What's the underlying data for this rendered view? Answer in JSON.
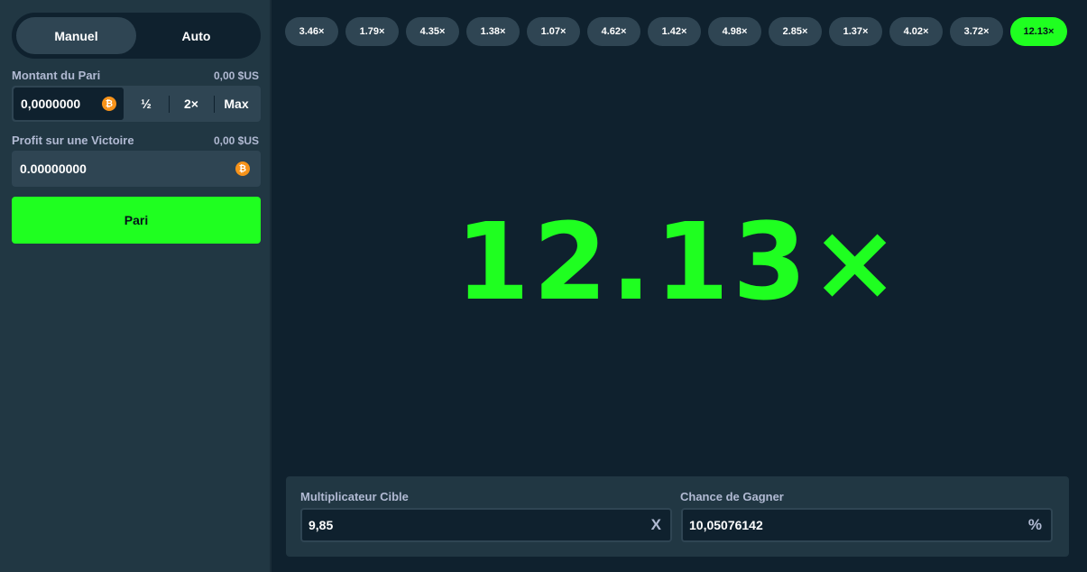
{
  "sidebar": {
    "mode_tabs": {
      "manual": "Manuel",
      "auto": "Auto",
      "active": "manual"
    },
    "bet_amount": {
      "label": "Montant du Pari",
      "usd": "0,00 $US",
      "value": "0,0000000",
      "ops": {
        "half": "½",
        "double": "2×",
        "max": "Max"
      }
    },
    "profit": {
      "label": "Profit sur une Victoire",
      "usd": "0,00 $US",
      "value": "0.00000000"
    },
    "bet_button": "Pari",
    "coin_symbol": "₿"
  },
  "history": [
    "3.46×",
    "1.79×",
    "4.35×",
    "1.38×",
    "1.07×",
    "4.62×",
    "1.42×",
    "4.98×",
    "2.85×",
    "1.37×",
    "4.02×",
    "3.72×",
    "12.13×"
  ],
  "result": {
    "multiplier": "12.13×",
    "color": "#1fff20"
  },
  "controls": {
    "target_multiplier": {
      "label": "Multiplicateur Cible",
      "value": "9,85",
      "suffix": "X"
    },
    "win_chance": {
      "label": "Chance de Gagner",
      "value": "10,05076142",
      "suffix": "%"
    }
  },
  "colors": {
    "background": "#0f212e",
    "panel": "#213743",
    "accent_green": "#1fff20",
    "chip": "#2f4553"
  }
}
